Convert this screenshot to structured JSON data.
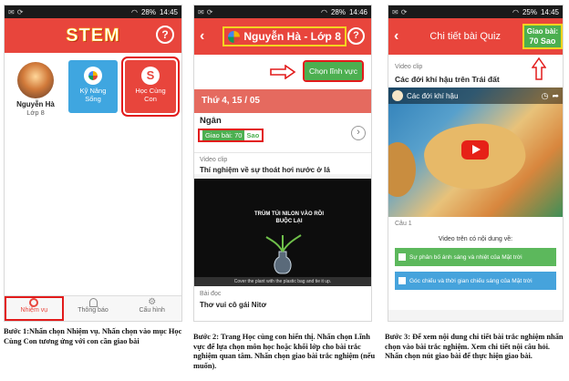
{
  "screen1": {
    "status": {
      "battery": "28%",
      "time": "14:45"
    },
    "logo": "STEM",
    "help_icon": "help-circle-icon",
    "profile": {
      "name": "Nguyễn Hà",
      "grade": "Lớp 8"
    },
    "cards": [
      {
        "label": "Kỹ Năng Sống",
        "color": "#3fa6e0"
      },
      {
        "label": "Học Cùng Con",
        "color": "#e8453c"
      }
    ],
    "nav": [
      {
        "label": "Nhiệm vụ",
        "icon": "target-icon"
      },
      {
        "label": "Thông báo",
        "icon": "bell-icon"
      },
      {
        "label": "Cấu hình",
        "icon": "gear-icon"
      }
    ]
  },
  "screen2": {
    "status": {
      "battery": "28%",
      "time": "14:46"
    },
    "title": "Nguyễn Hà - Lớp 8",
    "help_icon": "help-circle-icon",
    "choose_button": "Chọn lĩnh vực",
    "date": "Thứ 4, 15 / 05",
    "student": "Ngân",
    "assignment_label": "Giao bài: 70",
    "assignment_unit": "Sao",
    "video_section": "Video clip",
    "video_title": "Thí nghiệm về sự thoát hơi nước ở lá",
    "video_overlay": "TRÙM TÚI NILON VÀO RỒI BUỘC LẠI",
    "video_caption": "Cover the plant with the plastic bag and tie it up.",
    "reading_section": "Bài đọc",
    "reading_title": "Thơ vui cô gái Nitơ"
  },
  "screen3": {
    "status": {
      "battery": "25%",
      "time": "14:45"
    },
    "title": "Chi tiết bài Quiz",
    "badge_line1": "Giao bài:",
    "badge_line2": "70 Sao",
    "video_section": "Video clip",
    "video_heading": "Các đới khí hậu trên Trái đất",
    "video_inner_title": "Các đới khí hậu",
    "question_label": "Câu 1",
    "question_text": "Video trên có nội dung về:",
    "answers": [
      "Sự phân bố ánh sáng và nhiệt của Mặt trời",
      "Góc chiếu và thời gian chiếu sáng của Mặt trời"
    ]
  },
  "captions": {
    "c1": "Bước 1:Nhấn chọn Nhiệm vụ. Nhấn chọn vào mục Học Cùng Con  tương ứng với con cần giao bài",
    "c2": "Bước 2: Trang Học cùng con hiển thị. Nhấn chọn Lĩnh vực để lựa chọn môn học hoặc khối lớp  cho bài trắc  nghiệm quan tâm. Nhấn chọn giao bài trắc nghiệm (nếu muốn).",
    "c3": "Bước 3: Để xem nội dung chi tiết bài trắc nghiệm nhấn chọn vào bài trắc  nghiệm. Xem chi tiết nội  câu hỏi. Nhấn chọn nút giao bài để thực hiện giao bài."
  }
}
